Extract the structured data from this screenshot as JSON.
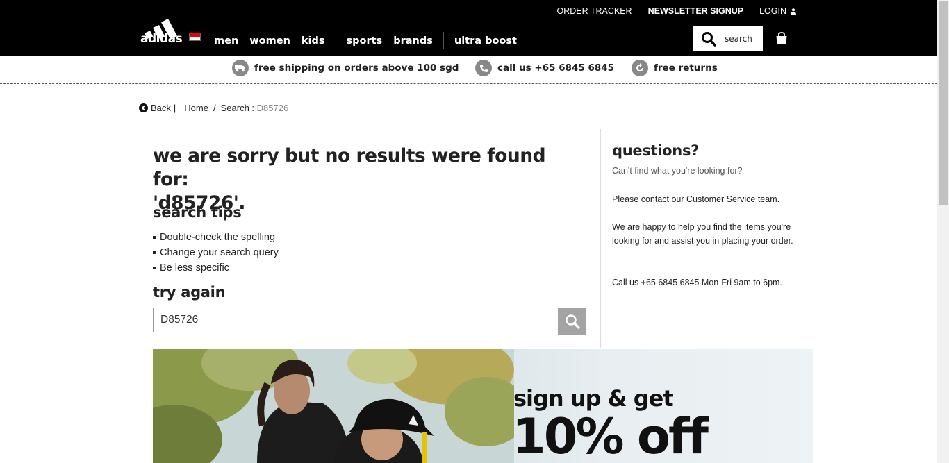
{
  "header": {
    "top_links": {
      "order_tracker": "ORDER TRACKER",
      "newsletter_signup": "NEWSLETTER SIGNUP",
      "login": "LOGIN"
    },
    "brand": "adidas",
    "nav": {
      "men": "men",
      "women": "women",
      "kids": "kids",
      "sports": "sports",
      "brands": "brands",
      "ultra_boost": "ultra boost"
    },
    "search_label": "search",
    "icons": {
      "search": "search-icon",
      "bag": "shopping-bag-icon",
      "user": "user-icon"
    }
  },
  "service_bar": {
    "shipping": "free shipping on orders above 100 sgd",
    "phone": "call us +65 6845 6845",
    "returns": "free returns"
  },
  "breadcrumb": {
    "back": "Back",
    "pipe": "|",
    "home": "Home",
    "sep": "/",
    "search_prefix": "Search :",
    "current": "D85726"
  },
  "main": {
    "no_results_line1": "we are sorry but no results were found for:",
    "no_results_line2": "'d85726'.",
    "tips_title": "search tips",
    "tips": [
      "Double-check the spelling",
      "Change your search query",
      "Be less specific"
    ],
    "try_again_title": "try again",
    "try_again_value": "D85726"
  },
  "sidebar": {
    "title": "questions?",
    "subtitle": "Can't find what you're looking for?",
    "contact": "Please contact our Customer Service team.",
    "help": "We are happy to help you find the items you're looking for and assist you in placing your order.",
    "call": "Call us +65 6845 6845  Mon-Fri 9am to 6pm."
  },
  "promo": {
    "line1": "sign up & get",
    "line2": "10% off"
  },
  "colors": {
    "header_bg": "#000000",
    "accent_grey": "#a3a3a3",
    "flag_red": "#ee0000"
  }
}
